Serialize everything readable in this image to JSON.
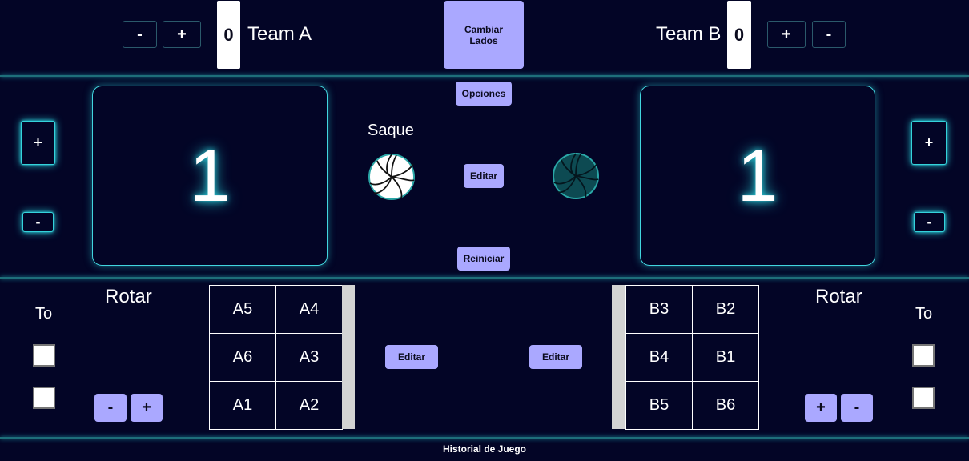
{
  "team_a": {
    "name": "Team A",
    "sets": "0",
    "minus": "-",
    "plus": "+"
  },
  "team_b": {
    "name": "Team B",
    "sets": "0",
    "minus": "-",
    "plus": "+"
  },
  "cambiar": "Cambiar Lados",
  "opciones": "Opciones",
  "reiniciar": "Reiniciar",
  "saque": "Saque",
  "editar": "Editar",
  "left": {
    "score": "1",
    "plus": "+",
    "minus": "-"
  },
  "right": {
    "score": "1",
    "plus": "+",
    "minus": "-"
  },
  "rotation": {
    "title": "Rotar",
    "to": "To",
    "left_grid": [
      "A5",
      "A4",
      "A6",
      "A3",
      "A1",
      "A2"
    ],
    "right_grid": [
      "B3",
      "B2",
      "B4",
      "B1",
      "B5",
      "B6"
    ],
    "left_minus": "-",
    "left_plus": "+",
    "right_plus": "+",
    "right_minus": "-",
    "edit_left": "Editar",
    "edit_right": "Editar"
  },
  "footer": "Historial de Juego",
  "colors": {
    "background": "#030526",
    "accent": "#aaa8ff",
    "glow": "#2ad0da"
  }
}
